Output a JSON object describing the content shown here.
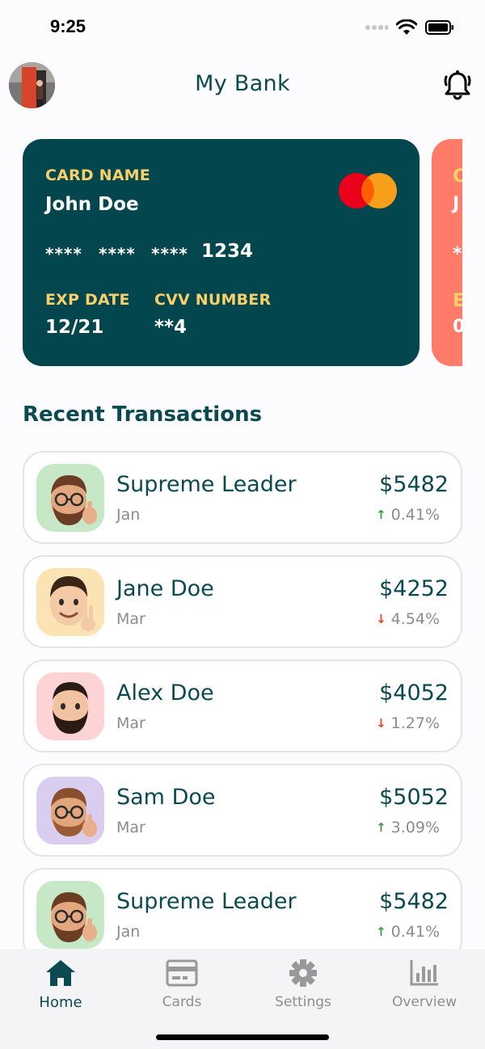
{
  "status_bar": {
    "time": "9:25"
  },
  "header": {
    "title": "My Bank"
  },
  "card": {
    "name_label": "CARD NAME",
    "name": "John Doe",
    "masked_groups": [
      "****",
      "****",
      "****"
    ],
    "last_four": "1234",
    "exp_label": "EXP DATE",
    "exp_value": "12/21",
    "cvv_label": "CVV NUMBER",
    "cvv_value": "**4",
    "brand_icon": "mastercard-logo",
    "bg_color": "#03464d",
    "label_color": "#f8cf68"
  },
  "next_card": {
    "bg_color": "#fd7b68",
    "fragments": [
      "C",
      "J",
      "*",
      "E",
      "0"
    ]
  },
  "section": {
    "title": "Recent Transactions"
  },
  "transactions": [
    {
      "name": "Supreme Leader",
      "date": "Jan",
      "amount": "$5482",
      "change": "0.41%",
      "direction": "up",
      "avatar_bg": "#c7e8c7",
      "avatar_icon": "bearded-glasses-thumbsup-memoji-icon"
    },
    {
      "name": "Jane Doe",
      "date": "Mar",
      "amount": "$4252",
      "change": "4.54%",
      "direction": "down",
      "avatar_bg": "#fce3b3",
      "avatar_icon": "peace-sign-memoji-icon"
    },
    {
      "name": "Alex Doe",
      "date": "Mar",
      "amount": "$4052",
      "change": "1.27%",
      "direction": "down",
      "avatar_bg": "#fdd3d6",
      "avatar_icon": "bearded-memoji-icon"
    },
    {
      "name": "Sam Doe",
      "date": "Mar",
      "amount": "$5052",
      "change": "3.09%",
      "direction": "up",
      "avatar_bg": "#d9cdf0",
      "avatar_icon": "glasses-thumbsup-memoji-icon"
    },
    {
      "name": "Supreme Leader",
      "date": "Jan",
      "amount": "$5482",
      "change": "0.41%",
      "direction": "up",
      "avatar_bg": "#c7e8c7",
      "avatar_icon": "bearded-glasses-thumbsup-memoji-icon"
    }
  ],
  "tabs": [
    {
      "label": "Home",
      "icon": "home-icon",
      "active": true
    },
    {
      "label": "Cards",
      "icon": "card-icon",
      "active": false
    },
    {
      "label": "Settings",
      "icon": "gear-icon",
      "active": false
    },
    {
      "label": "Overview",
      "icon": "bar-chart-icon",
      "active": false
    }
  ]
}
